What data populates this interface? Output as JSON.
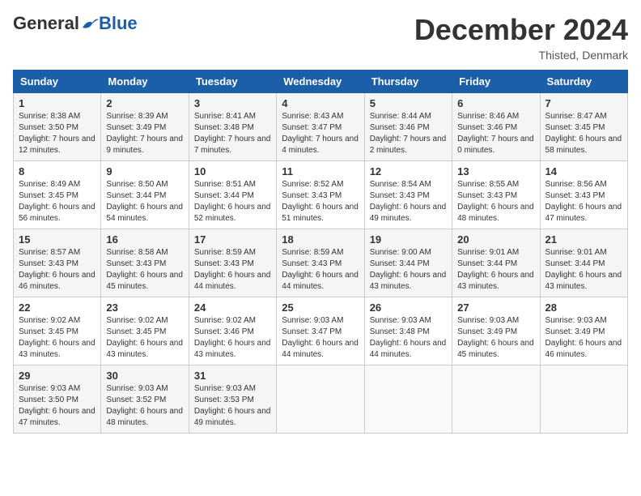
{
  "header": {
    "logo_general": "General",
    "logo_blue": "Blue",
    "month_title": "December 2024",
    "location": "Thisted, Denmark"
  },
  "days_of_week": [
    "Sunday",
    "Monday",
    "Tuesday",
    "Wednesday",
    "Thursday",
    "Friday",
    "Saturday"
  ],
  "weeks": [
    [
      {
        "day": "1",
        "sunrise": "Sunrise: 8:38 AM",
        "sunset": "Sunset: 3:50 PM",
        "daylight": "Daylight: 7 hours and 12 minutes."
      },
      {
        "day": "2",
        "sunrise": "Sunrise: 8:39 AM",
        "sunset": "Sunset: 3:49 PM",
        "daylight": "Daylight: 7 hours and 9 minutes."
      },
      {
        "day": "3",
        "sunrise": "Sunrise: 8:41 AM",
        "sunset": "Sunset: 3:48 PM",
        "daylight": "Daylight: 7 hours and 7 minutes."
      },
      {
        "day": "4",
        "sunrise": "Sunrise: 8:43 AM",
        "sunset": "Sunset: 3:47 PM",
        "daylight": "Daylight: 7 hours and 4 minutes."
      },
      {
        "day": "5",
        "sunrise": "Sunrise: 8:44 AM",
        "sunset": "Sunset: 3:46 PM",
        "daylight": "Daylight: 7 hours and 2 minutes."
      },
      {
        "day": "6",
        "sunrise": "Sunrise: 8:46 AM",
        "sunset": "Sunset: 3:46 PM",
        "daylight": "Daylight: 7 hours and 0 minutes."
      },
      {
        "day": "7",
        "sunrise": "Sunrise: 8:47 AM",
        "sunset": "Sunset: 3:45 PM",
        "daylight": "Daylight: 6 hours and 58 minutes."
      }
    ],
    [
      {
        "day": "8",
        "sunrise": "Sunrise: 8:49 AM",
        "sunset": "Sunset: 3:45 PM",
        "daylight": "Daylight: 6 hours and 56 minutes."
      },
      {
        "day": "9",
        "sunrise": "Sunrise: 8:50 AM",
        "sunset": "Sunset: 3:44 PM",
        "daylight": "Daylight: 6 hours and 54 minutes."
      },
      {
        "day": "10",
        "sunrise": "Sunrise: 8:51 AM",
        "sunset": "Sunset: 3:44 PM",
        "daylight": "Daylight: 6 hours and 52 minutes."
      },
      {
        "day": "11",
        "sunrise": "Sunrise: 8:52 AM",
        "sunset": "Sunset: 3:43 PM",
        "daylight": "Daylight: 6 hours and 51 minutes."
      },
      {
        "day": "12",
        "sunrise": "Sunrise: 8:54 AM",
        "sunset": "Sunset: 3:43 PM",
        "daylight": "Daylight: 6 hours and 49 minutes."
      },
      {
        "day": "13",
        "sunrise": "Sunrise: 8:55 AM",
        "sunset": "Sunset: 3:43 PM",
        "daylight": "Daylight: 6 hours and 48 minutes."
      },
      {
        "day": "14",
        "sunrise": "Sunrise: 8:56 AM",
        "sunset": "Sunset: 3:43 PM",
        "daylight": "Daylight: 6 hours and 47 minutes."
      }
    ],
    [
      {
        "day": "15",
        "sunrise": "Sunrise: 8:57 AM",
        "sunset": "Sunset: 3:43 PM",
        "daylight": "Daylight: 6 hours and 46 minutes."
      },
      {
        "day": "16",
        "sunrise": "Sunrise: 8:58 AM",
        "sunset": "Sunset: 3:43 PM",
        "daylight": "Daylight: 6 hours and 45 minutes."
      },
      {
        "day": "17",
        "sunrise": "Sunrise: 8:59 AM",
        "sunset": "Sunset: 3:43 PM",
        "daylight": "Daylight: 6 hours and 44 minutes."
      },
      {
        "day": "18",
        "sunrise": "Sunrise: 8:59 AM",
        "sunset": "Sunset: 3:43 PM",
        "daylight": "Daylight: 6 hours and 44 minutes."
      },
      {
        "day": "19",
        "sunrise": "Sunrise: 9:00 AM",
        "sunset": "Sunset: 3:44 PM",
        "daylight": "Daylight: 6 hours and 43 minutes."
      },
      {
        "day": "20",
        "sunrise": "Sunrise: 9:01 AM",
        "sunset": "Sunset: 3:44 PM",
        "daylight": "Daylight: 6 hours and 43 minutes."
      },
      {
        "day": "21",
        "sunrise": "Sunrise: 9:01 AM",
        "sunset": "Sunset: 3:44 PM",
        "daylight": "Daylight: 6 hours and 43 minutes."
      }
    ],
    [
      {
        "day": "22",
        "sunrise": "Sunrise: 9:02 AM",
        "sunset": "Sunset: 3:45 PM",
        "daylight": "Daylight: 6 hours and 43 minutes."
      },
      {
        "day": "23",
        "sunrise": "Sunrise: 9:02 AM",
        "sunset": "Sunset: 3:45 PM",
        "daylight": "Daylight: 6 hours and 43 minutes."
      },
      {
        "day": "24",
        "sunrise": "Sunrise: 9:02 AM",
        "sunset": "Sunset: 3:46 PM",
        "daylight": "Daylight: 6 hours and 43 minutes."
      },
      {
        "day": "25",
        "sunrise": "Sunrise: 9:03 AM",
        "sunset": "Sunset: 3:47 PM",
        "daylight": "Daylight: 6 hours and 44 minutes."
      },
      {
        "day": "26",
        "sunrise": "Sunrise: 9:03 AM",
        "sunset": "Sunset: 3:48 PM",
        "daylight": "Daylight: 6 hours and 44 minutes."
      },
      {
        "day": "27",
        "sunrise": "Sunrise: 9:03 AM",
        "sunset": "Sunset: 3:49 PM",
        "daylight": "Daylight: 6 hours and 45 minutes."
      },
      {
        "day": "28",
        "sunrise": "Sunrise: 9:03 AM",
        "sunset": "Sunset: 3:49 PM",
        "daylight": "Daylight: 6 hours and 46 minutes."
      }
    ],
    [
      {
        "day": "29",
        "sunrise": "Sunrise: 9:03 AM",
        "sunset": "Sunset: 3:50 PM",
        "daylight": "Daylight: 6 hours and 47 minutes."
      },
      {
        "day": "30",
        "sunrise": "Sunrise: 9:03 AM",
        "sunset": "Sunset: 3:52 PM",
        "daylight": "Daylight: 6 hours and 48 minutes."
      },
      {
        "day": "31",
        "sunrise": "Sunrise: 9:03 AM",
        "sunset": "Sunset: 3:53 PM",
        "daylight": "Daylight: 6 hours and 49 minutes."
      },
      null,
      null,
      null,
      null
    ]
  ]
}
